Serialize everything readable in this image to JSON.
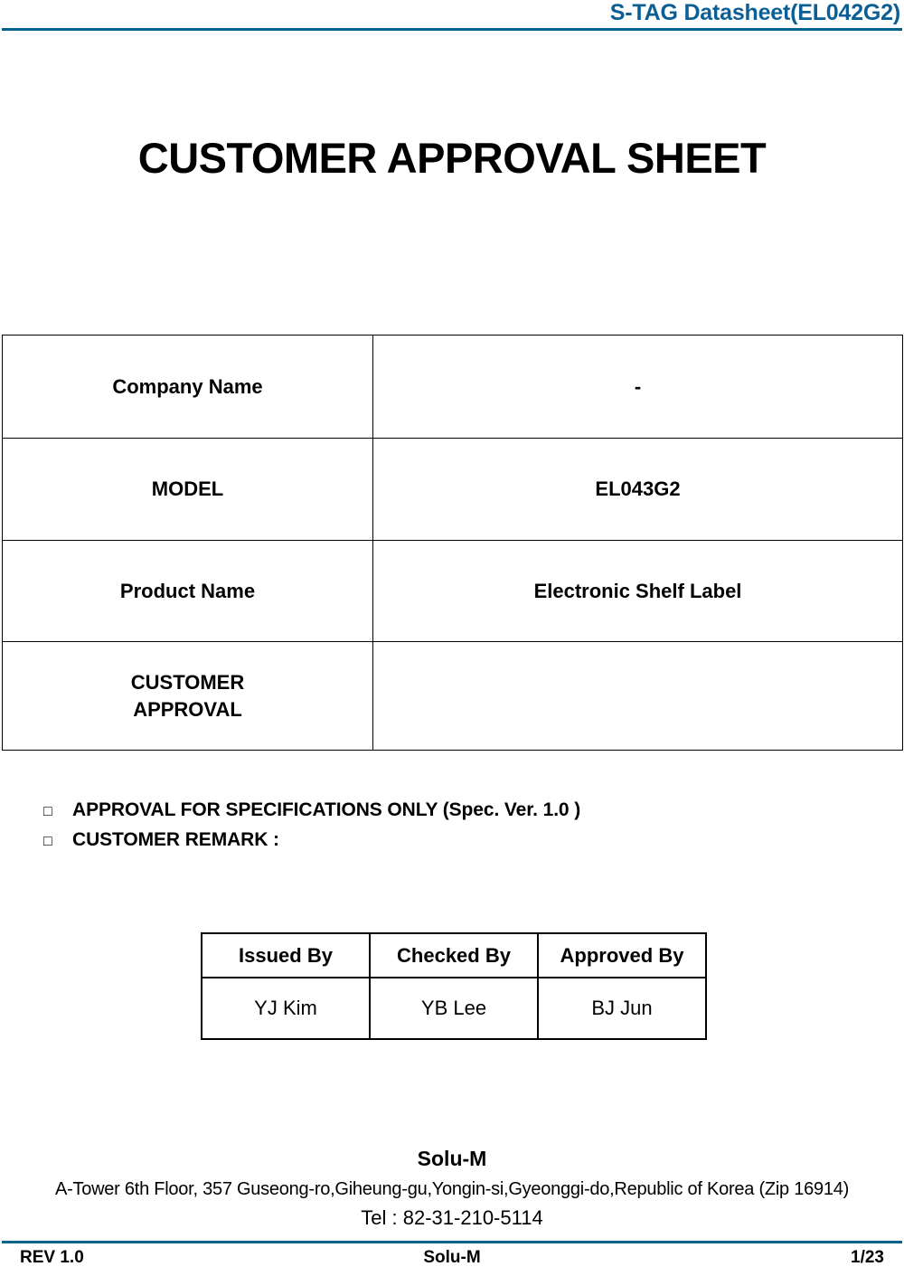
{
  "header": {
    "title": "S-TAG Datasheet(EL042G2)",
    "rule_color": "#00628f"
  },
  "document": {
    "title": "CUSTOMER APPROVAL SHEET"
  },
  "info_table": {
    "rows": [
      {
        "label": "Company Name",
        "value": "-"
      },
      {
        "label": "MODEL",
        "value": "EL043G2"
      },
      {
        "label": "Product Name",
        "value": "Electronic Shelf Label"
      },
      {
        "label_line1": "CUSTOMER",
        "label_line2": "APPROVAL",
        "value": ""
      }
    ]
  },
  "notes": {
    "bullet_glyph": "□",
    "items": [
      "APPROVAL FOR SPECIFICATIONS ONLY (Spec. Ver. 1.0 )",
      "CUSTOMER REMARK :"
    ]
  },
  "signature_table": {
    "headers": [
      "Issued By",
      "Checked By",
      "Approved By"
    ],
    "values": [
      "YJ Kim",
      "YB Lee",
      "BJ Jun"
    ]
  },
  "company": {
    "name": "Solu-M",
    "address": "A-Tower 6th Floor, 357 Guseong-ro,Giheung-gu,Yongin-si,Gyeonggi-do,Republic of Korea (Zip 16914)",
    "tel": "Tel : 82-31-210-5114"
  },
  "footer": {
    "revision": "REV 1.0",
    "center": "Solu-M",
    "page": "1/23"
  }
}
